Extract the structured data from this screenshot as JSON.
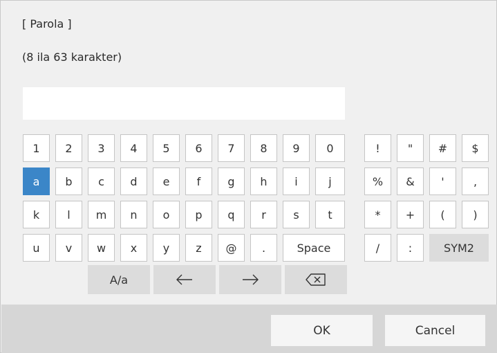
{
  "dialog": {
    "title": "[ Parola ]",
    "subtitle": "(8 ila 63 karakter)",
    "password_value": ""
  },
  "keyboard": {
    "row1": [
      "1",
      "2",
      "3",
      "4",
      "5",
      "6",
      "7",
      "8",
      "9",
      "0"
    ],
    "row2": [
      "a",
      "b",
      "c",
      "d",
      "e",
      "f",
      "g",
      "h",
      "i",
      "j"
    ],
    "row3": [
      "k",
      "l",
      "m",
      "n",
      "o",
      "p",
      "q",
      "r",
      "s",
      "t"
    ],
    "row4": [
      "u",
      "v",
      "w",
      "x",
      "y",
      "z",
      "@",
      "."
    ],
    "space_label": "Space",
    "case_label": "A/a",
    "selected_key": "a",
    "left_arrow_icon": "arrow-left-icon",
    "right_arrow_icon": "arrow-right-icon",
    "backspace_icon": "backspace-icon"
  },
  "symbols": {
    "row1": [
      "!",
      "\"",
      "#",
      "$"
    ],
    "row2": [
      "%",
      "&",
      "'",
      ","
    ],
    "row3": [
      "*",
      "+",
      "(",
      ")"
    ],
    "row4": [
      "/",
      ":"
    ],
    "sym2_label": "SYM2"
  },
  "buttons": {
    "ok_label": "OK",
    "cancel_label": "Cancel"
  }
}
